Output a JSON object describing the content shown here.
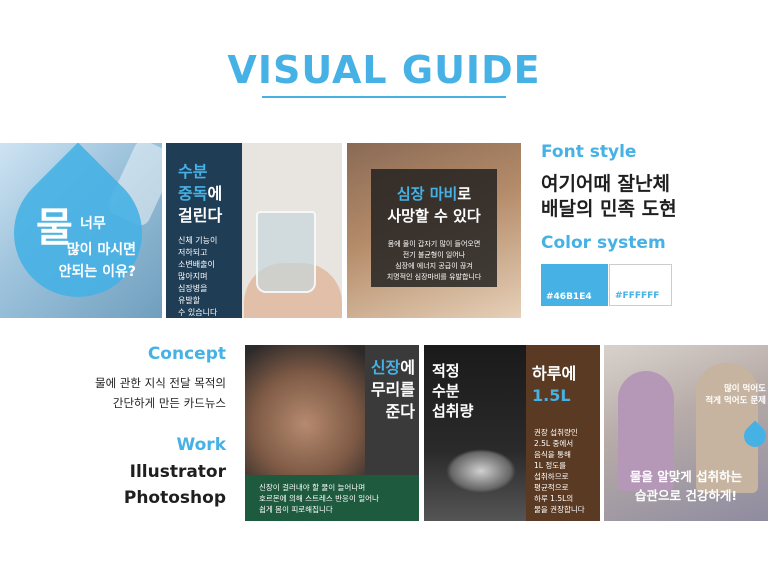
{
  "title": "VISUAL GUIDE",
  "card1": {
    "big": "물",
    "small": "너무",
    "line1": "많이 마시면",
    "line2": "안되는 이유?"
  },
  "card2": {
    "h1_blue": "수분",
    "h2_blue": "중독",
    "h2_rest": "에",
    "h3": "걸린다",
    "body": [
      "신체 기능이",
      "저하되고",
      "소변배출이",
      "많아지며",
      "심장병을",
      "유발할",
      "수 있습니다"
    ]
  },
  "card3": {
    "h1_blue": "심장 마비",
    "h1_rest": "로",
    "h2": "사망할 수 있다",
    "body": [
      "몸에 물이 갑자기 많이 들어오면",
      "전기 불균형이 일어나",
      "심장에 에너지 공급이 끊겨",
      "치명적인 심장마비를 유발합니다"
    ]
  },
  "font_style": {
    "label": "Font style",
    "font1": "여기어때 잘난체",
    "font2": "배달의 민족 도현"
  },
  "color_system": {
    "label": "Color system",
    "swatches": [
      {
        "hex": "#46B1E4",
        "label": "#46B1E4"
      },
      {
        "hex": "#FFFFFF",
        "label": "#FFFFFF"
      }
    ]
  },
  "concept": {
    "label": "Concept",
    "line1": "물에 관한 지식 전달 목적의",
    "line2": "간단하게 만든 카드뉴스"
  },
  "work": {
    "label": "Work",
    "tool1": "Illustrator",
    "tool2": "Photoshop"
  },
  "card4": {
    "h1_blue": "신장",
    "h1_rest": "에",
    "h2": "무리를",
    "h3": "준다",
    "body": [
      "신장이 걸러내야 할 물이 늘어나며",
      "호르몬에 의해 스트레스 반응이 일어나",
      "쉽게 몸이 피로해집니다"
    ]
  },
  "card5": {
    "l1": "적정",
    "l2": "수분",
    "l3": "섭취량",
    "r1": "하루에",
    "r2_blue": "1.5L",
    "body": [
      "권장 섭취량인",
      "2.5L 중에서",
      "음식을 통해",
      "1L 정도를",
      "섭취하므로",
      "평균적으로",
      "하루 1.5L의",
      "물을 권장합니다"
    ]
  },
  "card6": {
    "top1": "많이 먹어도",
    "top2": "적게 먹어도 문제",
    "h1": "물을 알맞게 섭취하는",
    "h2": "습관으로 건강하게!"
  }
}
